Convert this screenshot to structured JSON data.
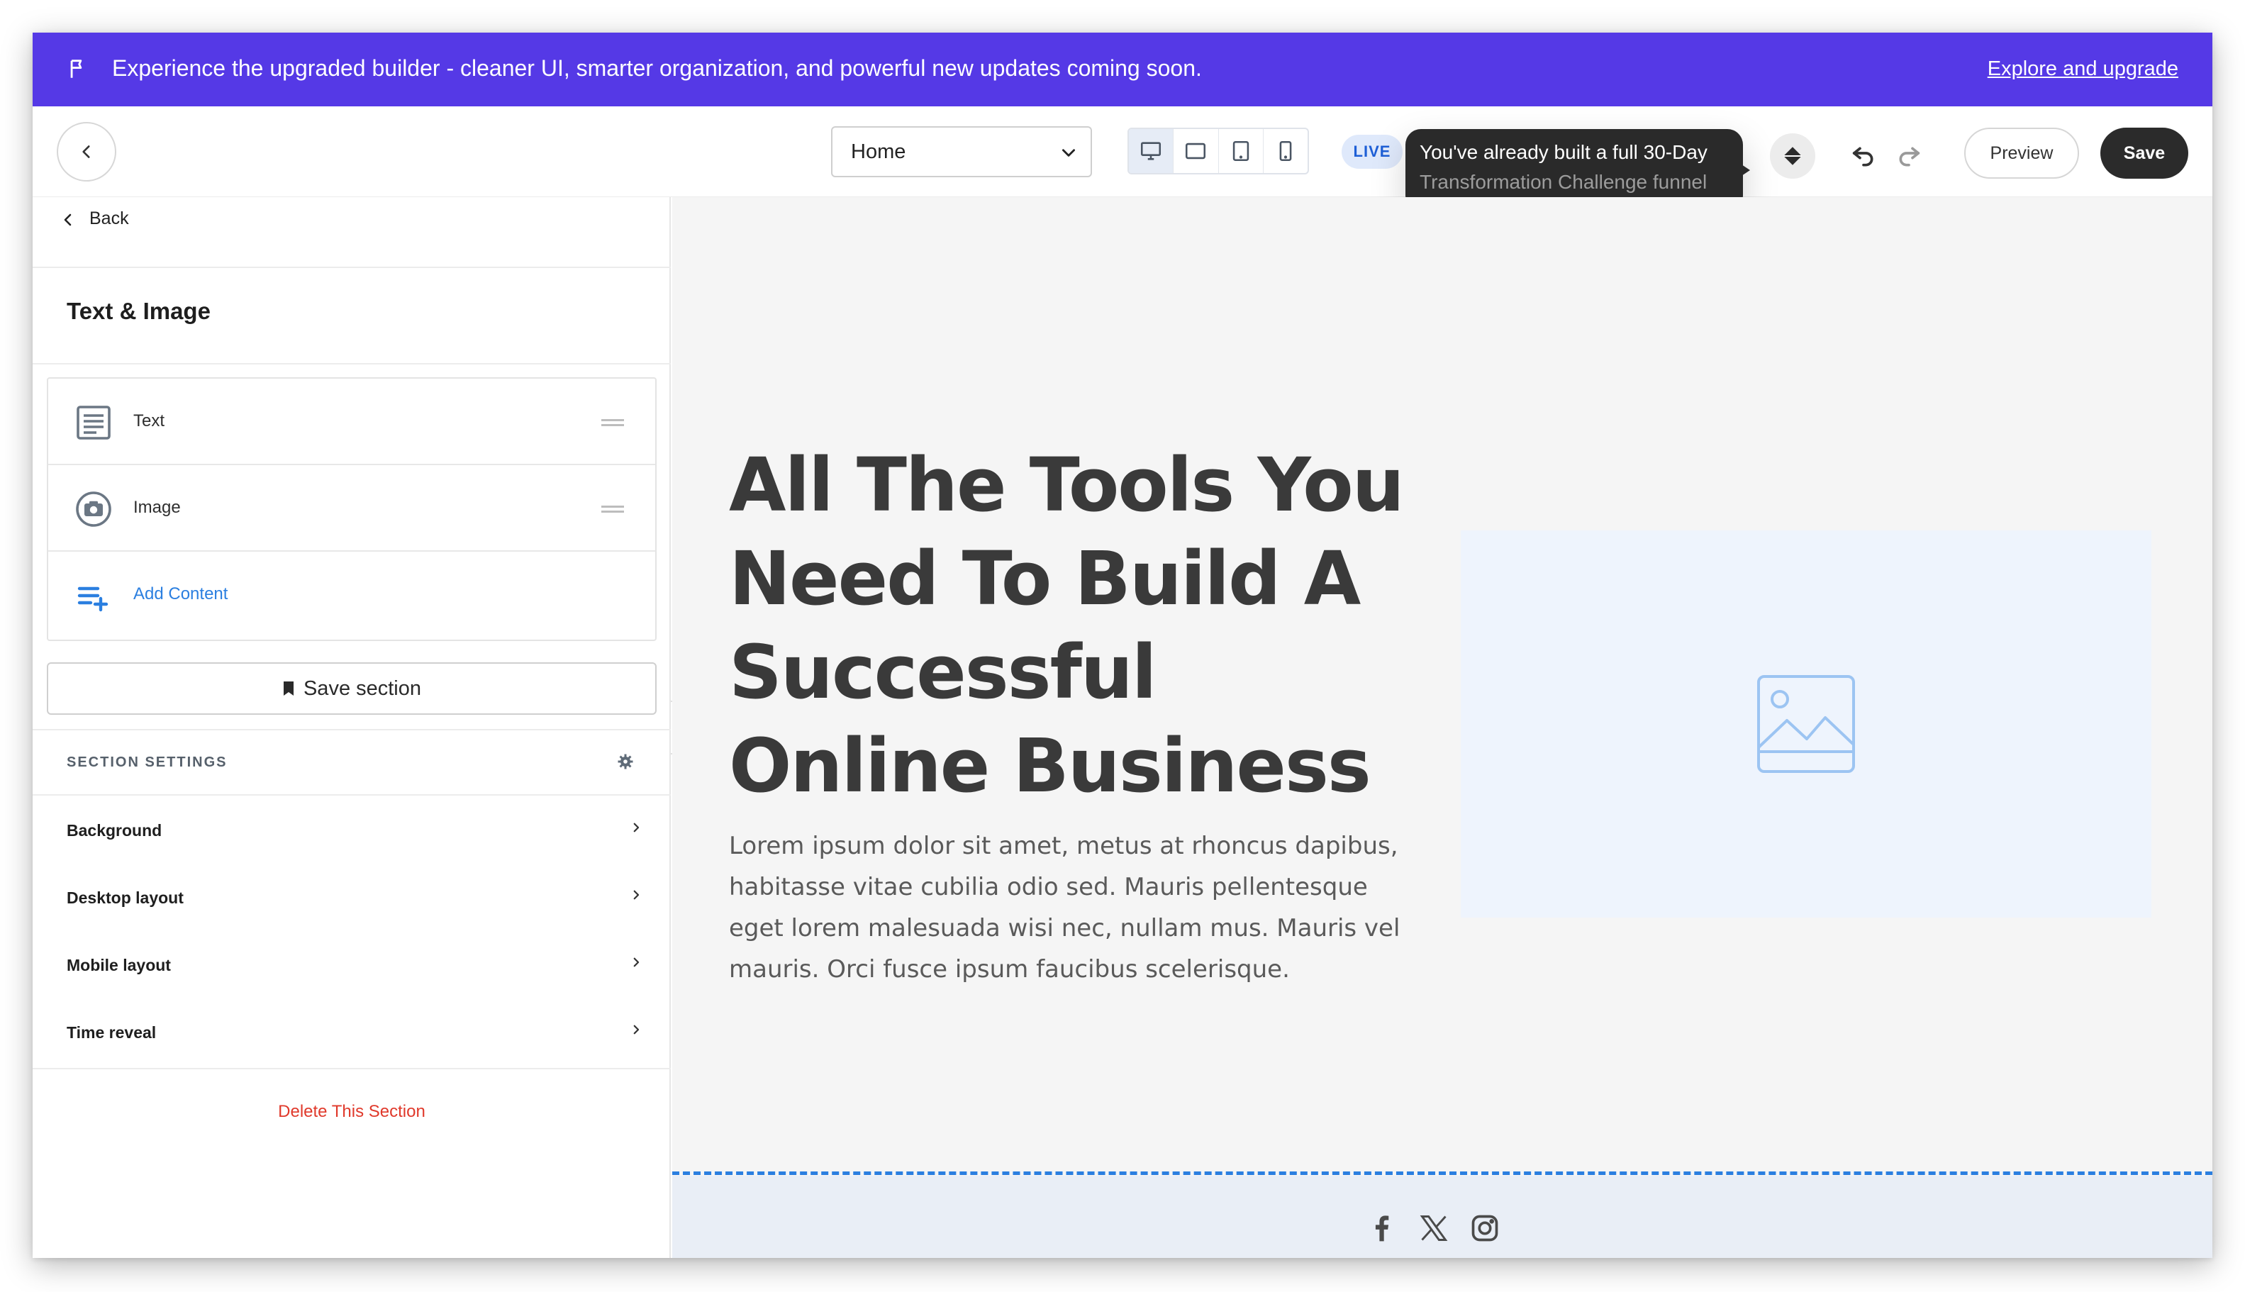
{
  "banner": {
    "message": "Experience the upgraded builder - cleaner UI, smarter organization, and powerful new updates coming soon.",
    "link": "Explore and upgrade",
    "color": "#5539e6"
  },
  "toolbar": {
    "page_select": "Home",
    "devices": [
      "desktop-icon",
      "tablet-landscape-icon",
      "tablet-portrait-icon",
      "mobile-icon"
    ],
    "active_device": "desktop",
    "live_badge": "LIVE",
    "tooltip_line1": "You've already built a full 30-Day",
    "tooltip_line2": "Transformation Challenge funnel",
    "preview": "Preview",
    "save": "Save"
  },
  "sidebar": {
    "back": "Back",
    "title": "Text & Image",
    "content_items": [
      {
        "label": "Text",
        "icon": "text-block-icon"
      },
      {
        "label": "Image",
        "icon": "camera-icon"
      }
    ],
    "add_content": "Add Content",
    "save_section": "Save section",
    "section_settings": "SECTION SETTINGS",
    "settings": [
      "Background",
      "Desktop layout",
      "Mobile layout",
      "Time reveal"
    ],
    "delete": "Delete This Section"
  },
  "canvas": {
    "heading": "All The Tools You Need To Build A Successful Online Business",
    "body": "Lorem ipsum dolor sit amet, metus at rhoncus dapibus, habitasse vitae cubilia odio sed. Mauris pellentesque eget lorem malesuada wisi nec, nullam mus. Mauris vel mauris. Orci fusce ipsum faucibus scelerisque.",
    "image_placeholder_icon": "image-placeholder-icon",
    "footer_icons": [
      "facebook-icon",
      "x-icon",
      "instagram-icon"
    ],
    "accent_color": "#2b7fe0"
  }
}
